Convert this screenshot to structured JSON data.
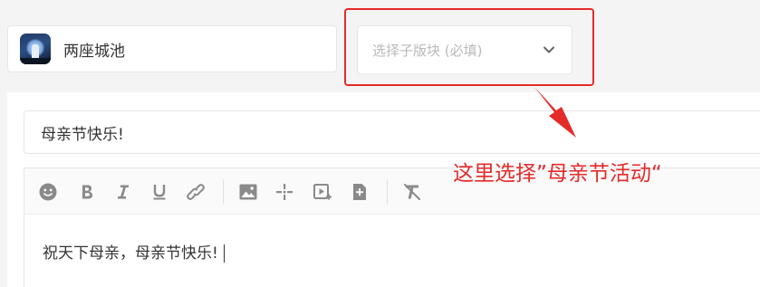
{
  "forum": {
    "name": "两座城池",
    "avatar_icon": "forum-avatar"
  },
  "subforum_select": {
    "placeholder": "选择子版块 (必填)",
    "icon": "chevron-down-icon"
  },
  "editor": {
    "title_value": "母亲节快乐!",
    "content_value": "祝天下母亲，母亲节快乐!",
    "toolbar_icons": [
      "emoji-icon",
      "bold-icon",
      "italic-icon",
      "underline-icon",
      "link-icon",
      "image-icon",
      "sparkle-icon",
      "video-icon",
      "file-add-icon",
      "clear-format-icon"
    ]
  },
  "annotation": {
    "text": "这里选择”母亲节活动“",
    "color": "#e52a2a"
  }
}
